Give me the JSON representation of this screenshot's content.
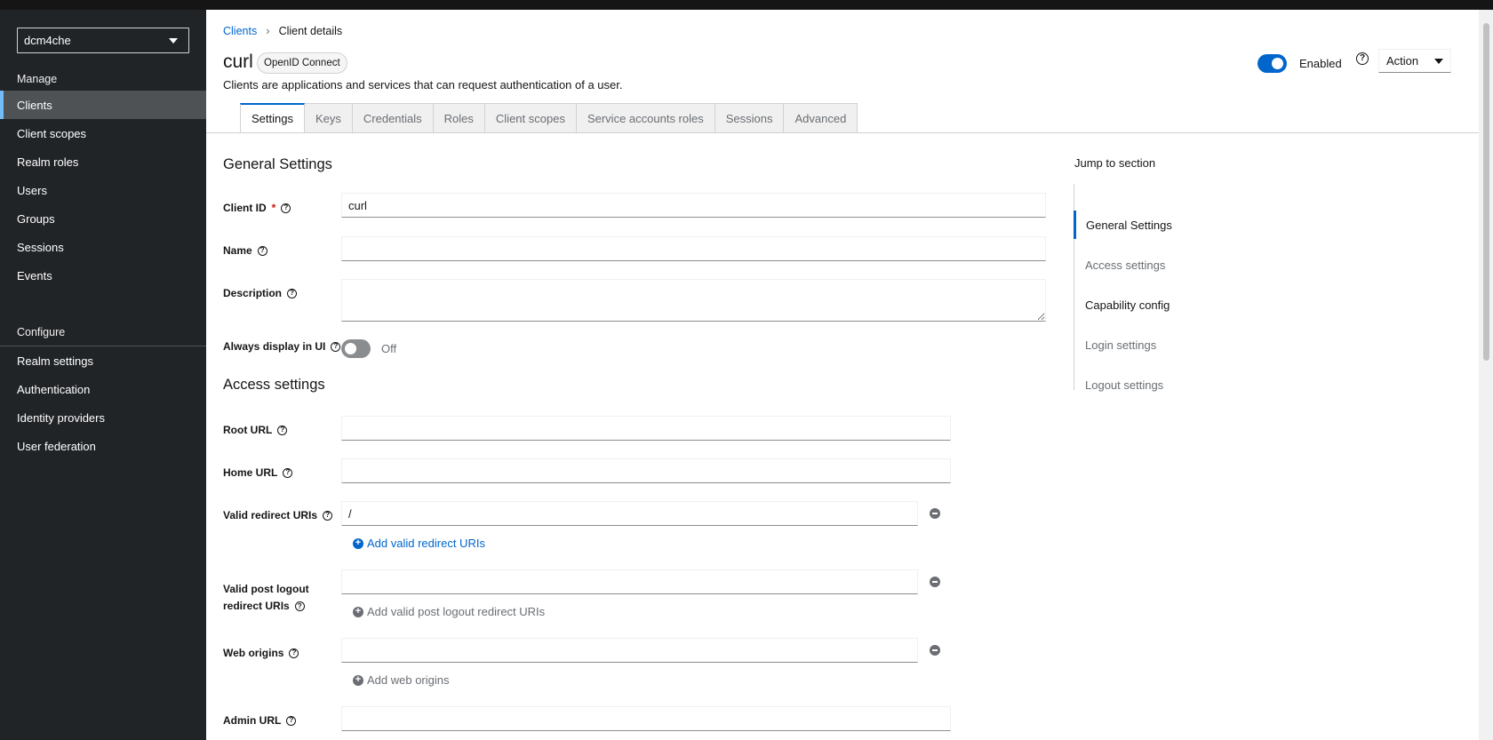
{
  "sidebar": {
    "realm": "dcm4che",
    "manage_label": "Manage",
    "configure_label": "Configure",
    "manage_items": [
      "Clients",
      "Client scopes",
      "Realm roles",
      "Users",
      "Groups",
      "Sessions",
      "Events"
    ],
    "configure_items": [
      "Realm settings",
      "Authentication",
      "Identity providers",
      "User federation"
    ],
    "active_item": "Clients"
  },
  "breadcrumb": {
    "parent": "Clients",
    "current": "Client details"
  },
  "header": {
    "title": "curl",
    "protocol_badge": "OpenID Connect",
    "subtitle": "Clients are applications and services that can request authentication of a user.",
    "enabled_label": "Enabled",
    "action_label": "Action"
  },
  "tabs": [
    "Settings",
    "Keys",
    "Credentials",
    "Roles",
    "Client scopes",
    "Service accounts roles",
    "Sessions",
    "Advanced"
  ],
  "general": {
    "heading": "General Settings",
    "client_id_label": "Client ID",
    "client_id_required": "*",
    "client_id_value": "curl",
    "name_label": "Name",
    "description_label": "Description",
    "always_display_label": "Always display in UI",
    "always_display_state": "Off"
  },
  "access": {
    "heading": "Access settings",
    "root_url_label": "Root URL",
    "home_url_label": "Home URL",
    "redirect_label": "Valid redirect URIs",
    "redirect_value": "/",
    "add_redirect": "Add valid redirect URIs",
    "post_logout_label_1": "Valid post logout",
    "post_logout_label_2": "redirect URIs",
    "add_post_logout": "Add valid post logout redirect URIs",
    "web_origins_label": "Web origins",
    "add_web_origins": "Add web origins",
    "admin_url_label": "Admin URL"
  },
  "jump": {
    "title": "Jump to section",
    "items": [
      "General Settings",
      "Access settings",
      "Capability config",
      "Login settings",
      "Logout settings"
    ]
  },
  "icons": {
    "help": "?",
    "plus": "+"
  },
  "colors": {
    "primary": "#0066cc",
    "sidebar": "#212427",
    "active_nav": "#4f5255"
  }
}
